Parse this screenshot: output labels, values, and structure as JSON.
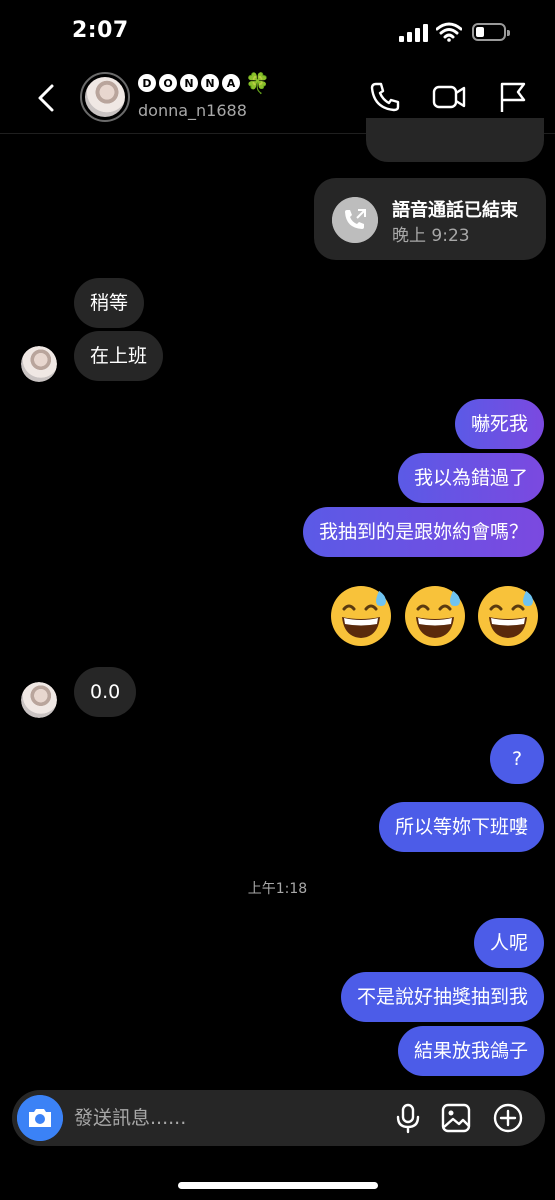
{
  "status_bar": {
    "time": "2:07",
    "battery_level": 0.3
  },
  "header": {
    "name_letters": [
      "D",
      "O",
      "N",
      "N",
      "A"
    ],
    "name_emoji": "🍀",
    "username": "donna_n1688",
    "icons": [
      "back-icon",
      "phone-icon",
      "video-icon",
      "flag-icon"
    ]
  },
  "call": {
    "title": "語音通話已結束",
    "time": "晚上 9:23"
  },
  "messages": [
    {
      "side": "in",
      "text": "稍等"
    },
    {
      "side": "in",
      "text": "在上班"
    },
    {
      "side": "out",
      "text": "嚇死我"
    },
    {
      "side": "out",
      "text": "我以為錯過了"
    },
    {
      "side": "out",
      "text": "我抽到的是跟妳約會嗎？"
    },
    {
      "side": "out",
      "text": "😅😅😅"
    },
    {
      "side": "in",
      "text": "0.0"
    },
    {
      "side": "out",
      "text": "?"
    },
    {
      "side": "out",
      "text": "所以等妳下班嘍"
    },
    {
      "side": "out",
      "text": "人呢"
    },
    {
      "side": "out",
      "text": "不是說好抽獎抽到我"
    },
    {
      "side": "out",
      "text": "結果放我鴿子"
    }
  ],
  "timestamp": "上午1:18",
  "composer": {
    "placeholder": "發送訊息......",
    "icons": [
      "camera-icon",
      "microphone-icon",
      "gallery-icon",
      "add-icon"
    ]
  },
  "colors": {
    "outgoing_start": "#5b5ae6",
    "outgoing_end": "#7b49e0",
    "outgoing_blue": "#4c5ce8",
    "incoming": "#262626",
    "camera": "#3b82f6"
  }
}
